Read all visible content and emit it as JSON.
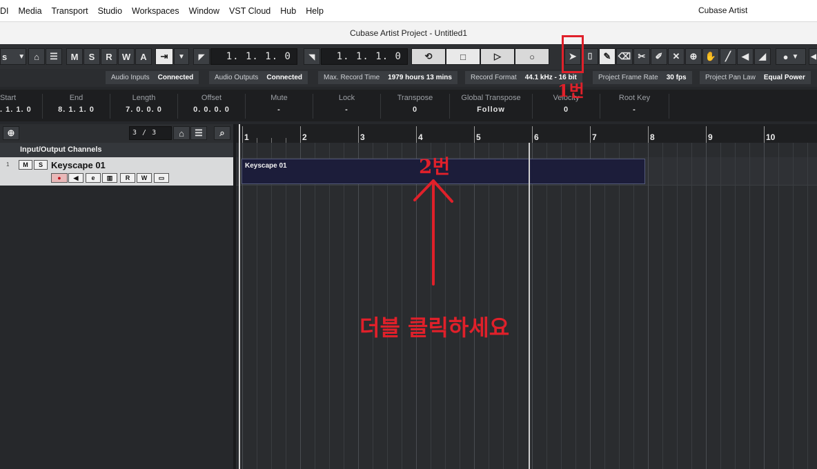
{
  "menubar": {
    "items": [
      "DI",
      "Media",
      "Transport",
      "Studio",
      "Workspaces",
      "Window",
      "VST Cloud",
      "Hub",
      "Help"
    ],
    "app_name": "Cubase Artist"
  },
  "window": {
    "title": "Cubase Artist Project - Untitled1"
  },
  "toolbar": {
    "left_clip_text": "s",
    "msrwa": [
      "M",
      "S",
      "R",
      "W",
      "A"
    ],
    "left_locator": "1. 1. 1.  0",
    "right_locator": "1. 1. 1.  0"
  },
  "status": [
    {
      "label": "Audio Inputs",
      "value": "Connected"
    },
    {
      "label": "Audio Outputs",
      "value": "Connected"
    },
    {
      "label": "Max. Record Time",
      "value": "1979 hours 13 mins"
    },
    {
      "label": "Record Format",
      "value": "44.1 kHz - 16 bit"
    },
    {
      "label": "Project Frame Rate",
      "value": "30 fps"
    },
    {
      "label": "Project Pan Law",
      "value": "Equal Power"
    }
  ],
  "info": [
    {
      "label": "Start",
      "value": ". 1. 1.  0"
    },
    {
      "label": "End",
      "value": "8. 1. 1.  0"
    },
    {
      "label": "Length",
      "value": "7. 0. 0.  0"
    },
    {
      "label": "Offset",
      "value": "0. 0. 0.  0"
    },
    {
      "label": "Mute",
      "value": "-"
    },
    {
      "label": "Lock",
      "value": "-"
    },
    {
      "label": "Transpose",
      "value": "0"
    },
    {
      "label": "Global Transpose",
      "value": "Follow"
    },
    {
      "label": "Velocity",
      "value": "0"
    },
    {
      "label": "Root Key",
      "value": "-"
    }
  ],
  "tracks": {
    "count": "3 / 3",
    "folder": "Input/Output Channels",
    "track_number": "1",
    "track_name": "Keyscape 01",
    "mute": "M",
    "solo": "S",
    "read": "R",
    "write": "W"
  },
  "ruler": {
    "bars": [
      "1",
      "2",
      "3",
      "4",
      "5",
      "6",
      "7",
      "8",
      "9",
      "10"
    ]
  },
  "event": {
    "name": "Keyscape 01"
  },
  "annotations": {
    "step1": "1번",
    "step2": "2번",
    "instruction": "더블 클릭하세요"
  },
  "colors": {
    "accent": "#e0202a",
    "event_bg": "#1c1d3a"
  }
}
